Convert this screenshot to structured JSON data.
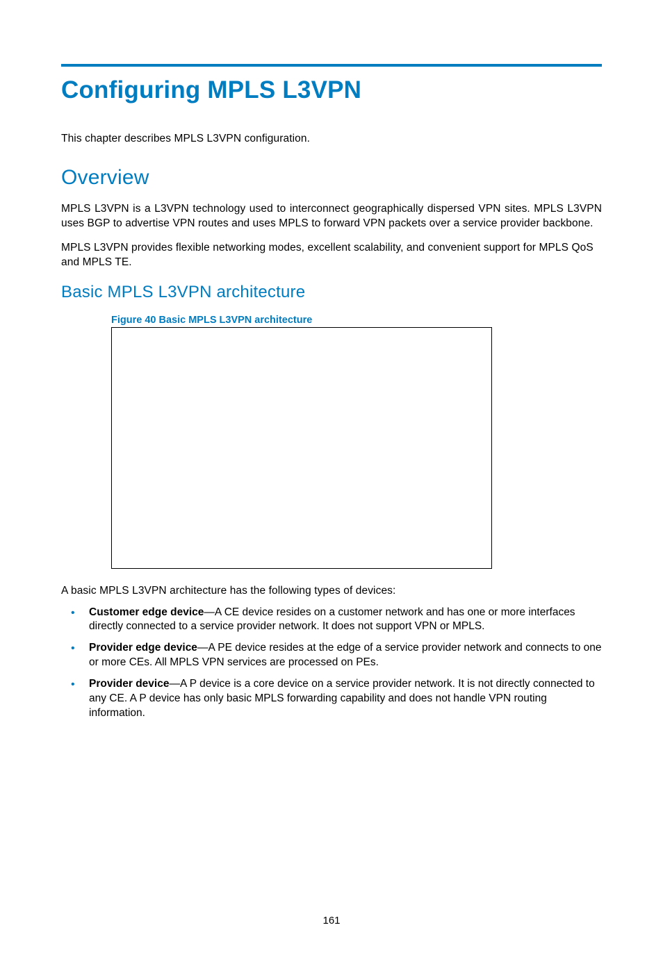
{
  "page": {
    "title": "Configuring MPLS L3VPN",
    "intro": "This chapter describes MPLS L3VPN configuration.",
    "h2_overview": "Overview",
    "overview_p1": "MPLS L3VPN is a L3VPN technology used to interconnect geographically dispersed VPN sites. MPLS L3VPN uses BGP to advertise VPN routes and uses MPLS to forward VPN packets over a service provider backbone.",
    "overview_p2": "MPLS L3VPN provides flexible networking modes, excellent scalability, and convenient support for MPLS QoS and MPLS TE.",
    "h3_arch": "Basic MPLS L3VPN architecture",
    "figure_caption": "Figure 40 Basic MPLS L3VPN architecture",
    "devices_intro": "A basic MPLS L3VPN architecture has the following types of devices:",
    "bullets": [
      {
        "term": "Customer edge device",
        "desc": "—A CE device resides on a customer network and has one or more interfaces directly connected to a service provider network. It does not support VPN or MPLS."
      },
      {
        "term": "Provider edge device",
        "desc": "—A PE device resides at the edge of a service provider network and connects to one or more CEs. All MPLS VPN services are processed on PEs."
      },
      {
        "term": "Provider device",
        "desc": "—A P device is a core device on a service provider network. It is not directly connected to any CE. A P device has only basic MPLS forwarding capability and does not handle VPN routing information."
      }
    ],
    "page_number": "161"
  }
}
